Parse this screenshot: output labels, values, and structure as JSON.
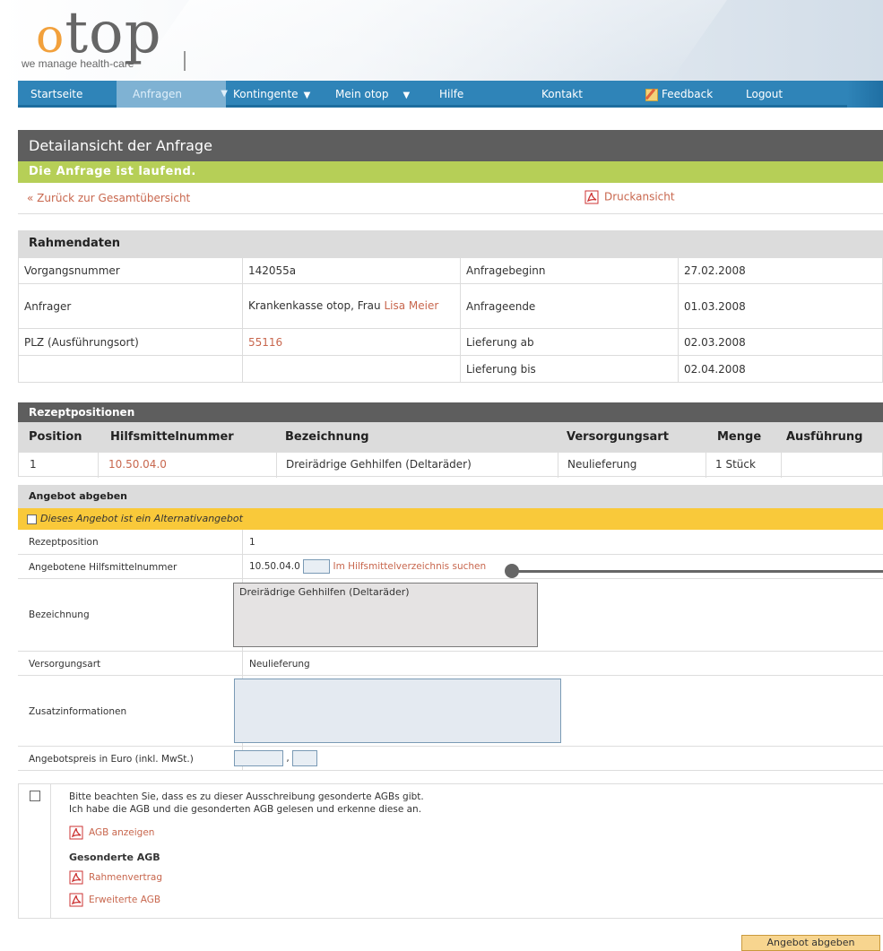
{
  "brand": {
    "logo_o": "o",
    "logo_rest": "top",
    "tagline": "we manage health-care"
  },
  "nav": [
    {
      "label": "Startseite",
      "dropdown": false
    },
    {
      "label": "Anfragen",
      "dropdown": true,
      "active": true
    },
    {
      "label": "Kontingente",
      "dropdown": true
    },
    {
      "label": "Mein otop",
      "dropdown": true
    },
    {
      "label": "Hilfe",
      "dropdown": false
    },
    {
      "label": "Kontakt",
      "dropdown": false
    },
    {
      "label": "Feedback",
      "dropdown": false,
      "icon": "feedback-icon"
    },
    {
      "label": "Logout",
      "dropdown": false
    }
  ],
  "page": {
    "title": "Detailansicht der Anfrage",
    "status": "Die Anfrage ist laufend.",
    "back_link": "« Zurück zur Gesamtübersicht",
    "print_link": "Druckansicht"
  },
  "rahmendaten": {
    "heading": "Rahmendaten",
    "rows": [
      {
        "l1": "Vorgangsnummer",
        "v1": "142055a",
        "l2": "Anfragebeginn",
        "v2": "27.02.2008"
      },
      {
        "l1": "Anfrager",
        "v1": "Krankenkasse otop, Frau ",
        "v1_link": "Lisa Meier",
        "l2": "Anfrageende",
        "v2": "01.03.2008"
      },
      {
        "l1": "PLZ (Ausführungsort)",
        "v1_link": "55116",
        "l2": "Lieferung ab",
        "v2": "02.03.2008"
      },
      {
        "l1": "",
        "v1": "",
        "l2": "Lieferung bis",
        "v2": "02.04.2008"
      }
    ]
  },
  "rezeptpositionen": {
    "heading": "Rezeptpositionen",
    "columns": [
      "Position",
      "Hilfsmittelnummer",
      "Bezeichnung",
      "Versorgungsart",
      "Menge",
      "Ausführung"
    ],
    "rows": [
      {
        "position": "1",
        "nummer": "10.50.04.0",
        "bezeichnung": "Dreirädrige Gehhilfen (Deltaräder)",
        "art": "Neulieferung",
        "menge": "1 Stück",
        "ausfuehrung": ""
      }
    ]
  },
  "angebot": {
    "heading": "Angebot abgeben",
    "alternative_label": "Dieses Angebot ist ein Alternativangebot",
    "rezeptposition_label": "Rezeptposition",
    "rezeptposition_value": "1",
    "nummer_label": "Angebotene Hilfsmittelnummer",
    "nummer_value": "10.50.04.0",
    "nummer_search_link": "Im Hilfsmittelverzeichnis suchen",
    "bezeichnung_label": "Bezeichnung",
    "bezeichnung_value": "Dreirädrige Gehhilfen (Deltaräder)",
    "versorgungsart_label": "Versorgungsart",
    "versorgungsart_value": "Neulieferung",
    "zusatz_label": "Zusatzinformationen",
    "preis_label": "Angebotspreis in Euro (inkl. MwSt.)",
    "preis_sep": ","
  },
  "agb": {
    "line1": "Bitte beachten Sie, dass es zu dieser Ausschreibung gesonderte AGBs gibt.",
    "line2": "Ich habe die AGB und die gesonderten AGB gelesen und erkenne diese an.",
    "agb_link": "AGB anzeigen",
    "gesondert_heading": "Gesonderte AGB",
    "link_rahmen": "Rahmenvertrag",
    "link_erweitert": "Erweiterte AGB"
  },
  "submit_label": "Angebot abgeben",
  "colors": {
    "nav": "#2f84b8",
    "status": "#b6cf57",
    "link": "#c8674e",
    "alt_row": "#f9c93a",
    "title_bar": "#5e5e5e"
  }
}
